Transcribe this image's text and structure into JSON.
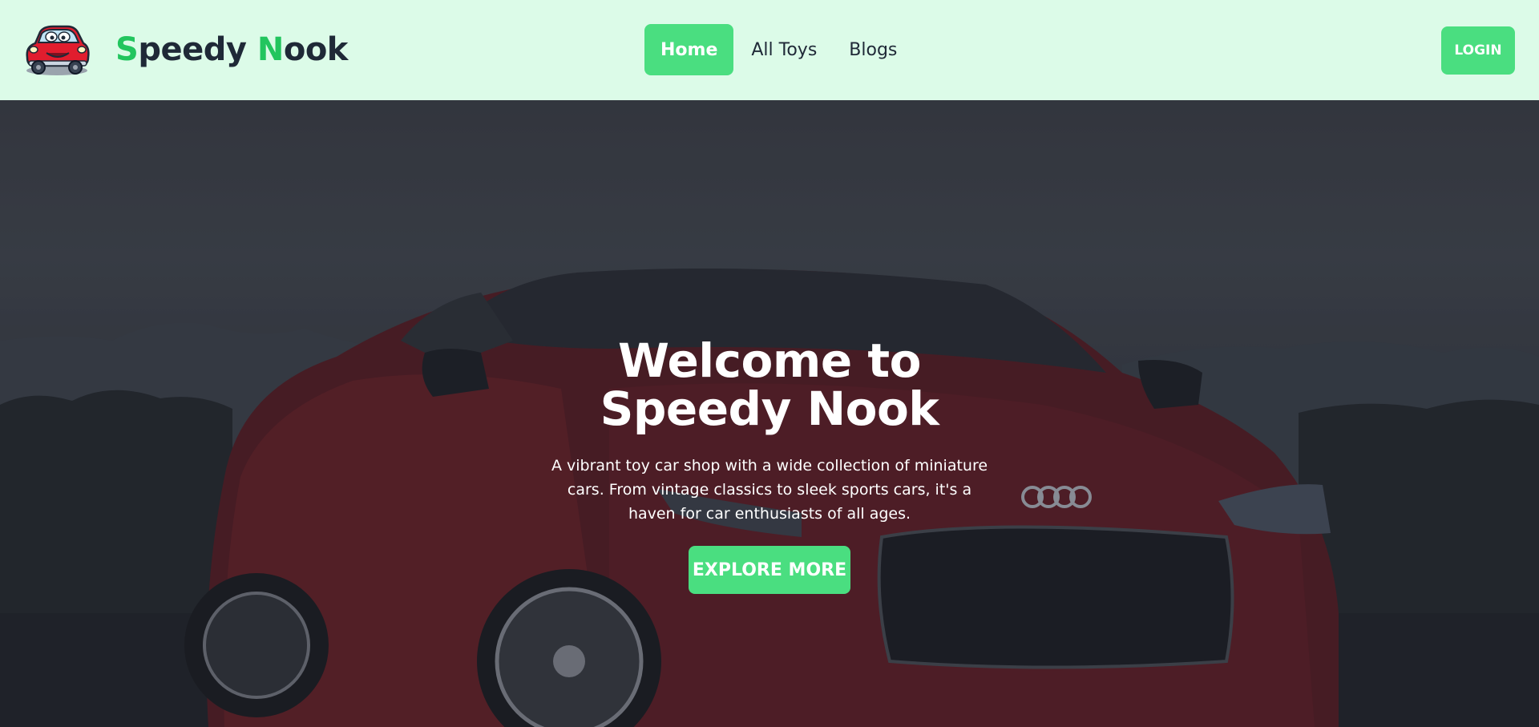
{
  "brand": {
    "logo_icon": "cartoon-red-car-icon",
    "name_first_initial": "S",
    "name_first_rest": "peedy",
    "name_second_initial": "N",
    "name_second_rest": "ook"
  },
  "nav": {
    "items": [
      {
        "label": "Home",
        "active": true
      },
      {
        "label": "All Toys",
        "active": false
      },
      {
        "label": "Blogs",
        "active": false
      }
    ],
    "login_label": "LOGIN"
  },
  "hero": {
    "background_icon": "red-sports-car-photo",
    "title": "Welcome to Speedy Nook",
    "description": "A vibrant toy car shop with a wide collection of miniature cars. From vintage classics to sleek sports cars, it's a haven for car enthusiasts of all ages.",
    "cta_label": "EXPLORE MORE"
  },
  "colors": {
    "accent": "#4ade80",
    "brand_green": "#22c55e",
    "navbar_bg": "#dcfbe8",
    "text_dark": "#1f2937"
  }
}
